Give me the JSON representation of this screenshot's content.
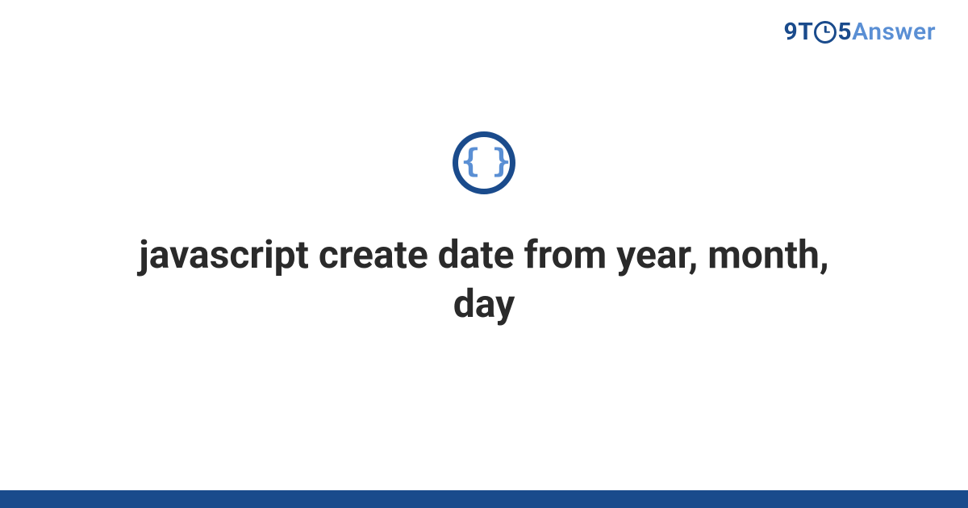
{
  "brand": {
    "part1": "9T",
    "part2": "5",
    "part3": "Answer"
  },
  "icon": {
    "braces": "{ }"
  },
  "title": "javascript create date from year, month, day"
}
